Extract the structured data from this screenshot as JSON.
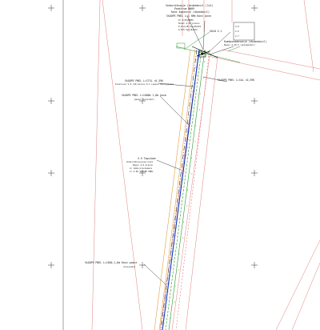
{
  "drawing": {
    "annotations": [
      {
        "id": "top-1",
        "lines": [
          "Vodovratnopje (dvubedovil (1x1)",
          "Podstrum NN09",
          "Kanv kopovnik (dovodovil)"
        ]
      },
      {
        "id": "top-2",
        "lines": [
          "SkOOPE PNEL L=1 SMm Konv pova",
          "Pr 4(25)BPES",
          "Nrast 4.43 pravno",
          "D_E(A)18 Svs(B)H22",
          "O_E15 Spc(B)Kdd"
        ]
      },
      {
        "id": "legend-box",
        "lines": [
          "SOLN V-1",
          "4.9",
          "2.5",
          "2.7"
        ]
      },
      {
        "id": "right-1",
        "lines": [
          "Kombovnadevanje (dvubedovil)",
          "Nvpov 2-29-3 (pnevmpodni)"
        ]
      },
      {
        "id": "right-2",
        "lines": [
          "SkOOPE PNEL L=1AL =0,396"
        ]
      },
      {
        "id": "left-1",
        "lines": [
          "SkOOPE PNEL L=1TSL =0,396",
          "Izvolivel V-9 (SD kovolu 0-1 Lasevv kovojvmode)"
        ]
      },
      {
        "id": "left-2",
        "lines": [
          "SkOOPE PNEL L=1000m 1,8m kova",
          "pasne (kovovaSl)"
        ]
      },
      {
        "id": "mid-1",
        "lines": [
          "V-9 Tepvtomt",
          "Vodovratnovjejve hvod",
          "Nvpov 4.9 pravno",
          "L= 1mmm pravnemenv",
          "L= 4.96 SkOOPE PNEL"
        ]
      },
      {
        "id": "bottom-1",
        "lines": [
          "SkOOPE PNEL L=1084,1,8m Konv pasne",
          "(kovovaSl)"
        ]
      }
    ]
  }
}
